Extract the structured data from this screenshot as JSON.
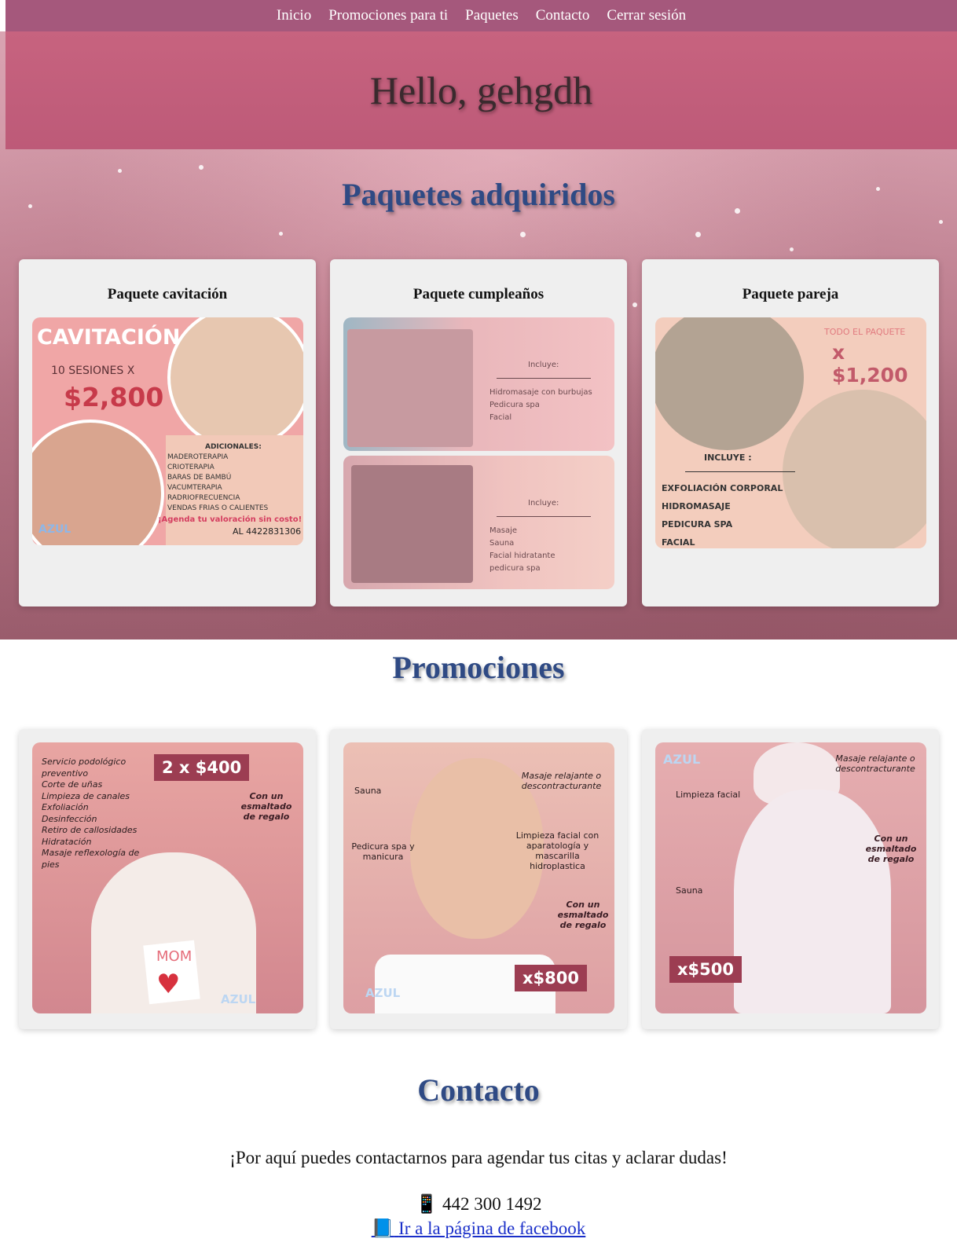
{
  "nav": {
    "items": [
      "Inicio",
      "Promociones para ti",
      "Paquetes",
      "Contacto",
      "Cerrar sesión"
    ]
  },
  "banner": {
    "greeting": "Hello, gehgdh"
  },
  "packages": {
    "title": "Paquetes adquiridos",
    "cards": [
      {
        "title": "Paquete cavitación",
        "image": {
          "heading": "CAVITACIÓN",
          "sessions": "10 SESIONES X",
          "price": "$2,800",
          "extras_title": "ADICIONALES:",
          "extras": [
            "MADEROTERAPIA",
            "CRIOTERAPIA",
            "BARAS DE BAMBÚ",
            "VACUMTERAPIA",
            "RADRIOFRECUENCIA",
            "VENDAS FRIAS O CALIENTES"
          ],
          "cta": "¡Agenda tu valoración sin costo!",
          "phone": "AL 4422831306",
          "brand": "AZUL"
        }
      },
      {
        "title": "Paquete cumpleaños",
        "image_top": {
          "heading": "Incluye:",
          "items": [
            "Hidromasaje con burbujas",
            "Pedicura spa",
            "Facial"
          ]
        },
        "image_bottom": {
          "heading": "Incluye:",
          "items": [
            "Masaje",
            "Sauna",
            "Facial hidratante",
            "pedicura spa"
          ]
        }
      },
      {
        "title": "Paquete pareja",
        "image": {
          "top_label": "TODO EL PAQUETE",
          "price": "x $1,200",
          "includes_title": "INCLUYE :",
          "includes": [
            "EXFOLIACIÓN CORPORAL",
            "HIDROMASAJE",
            "PEDICURA SPA",
            "FACIAL"
          ]
        }
      }
    ]
  },
  "promotions": {
    "title": "Promociones",
    "cards": [
      {
        "price": "2 x $400",
        "list": [
          "Servicio podológico preventivo",
          "Corte de uñas",
          "Limpieza de canales",
          "Exfoliación",
          "Desinfección",
          "Retiro de callosidades",
          "Hidratación",
          "Masaje reflexología de pies"
        ],
        "gift": "Con un esmaltado de regalo",
        "sign": "MOM",
        "brand": "AZUL"
      },
      {
        "price": "x$800",
        "labels": [
          "Sauna",
          "Masaje relajante o descontracturante",
          "Pedicura spa y manicura",
          "Limpieza facial con aparatología y mascarilla hidroplastica",
          "Con un esmaltado de regalo"
        ],
        "brand": "AZUL"
      },
      {
        "price": "x$500",
        "labels": [
          "Masaje relajante o descontracturante",
          "Limpieza facial",
          "Con un esmaltado de regalo",
          "Sauna"
        ],
        "brand": "AZUL"
      }
    ]
  },
  "contact": {
    "title": "Contacto",
    "text": "¡Por aquí puedes contactarnos para agendar tus citas y aclarar dudas!",
    "phone_icon": "📱",
    "phone": "442 300 1492",
    "fb_icon": "📘",
    "fb_link": "Ir a la página de facebook"
  },
  "colors": {
    "nav": "#a5587c",
    "banner": "#c7637f",
    "title": "#2f4a84",
    "card": "#efefef",
    "link": "#1a2fc9"
  }
}
